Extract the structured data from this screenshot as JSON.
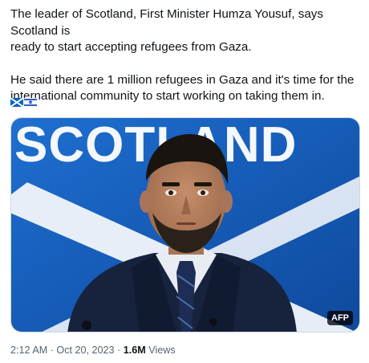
{
  "tweet": {
    "paragraphs": [
      "The leader of Scotland, First Minister Humza Yousuf, says Scotland is\nready to start accepting refugees from Gaza.",
      "He said there are 1 million refugees in Gaza and it's time for the\ninternational community to start working on taking them in."
    ],
    "flags": [
      "scotland-flag",
      "israel-flag"
    ],
    "media": {
      "backdrop_text": "SCOTLAND",
      "credit": "AFP"
    },
    "meta": {
      "time": "2:12 AM",
      "separator": "·",
      "date": "Oct 20, 2023",
      "views_count": "1.6M",
      "views_label": "Views"
    }
  },
  "colors": {
    "saltire_blue": "#1a5fb4",
    "backdrop_blue": "#1565c0",
    "text_secondary": "#536471",
    "text_primary": "#0f1419"
  }
}
